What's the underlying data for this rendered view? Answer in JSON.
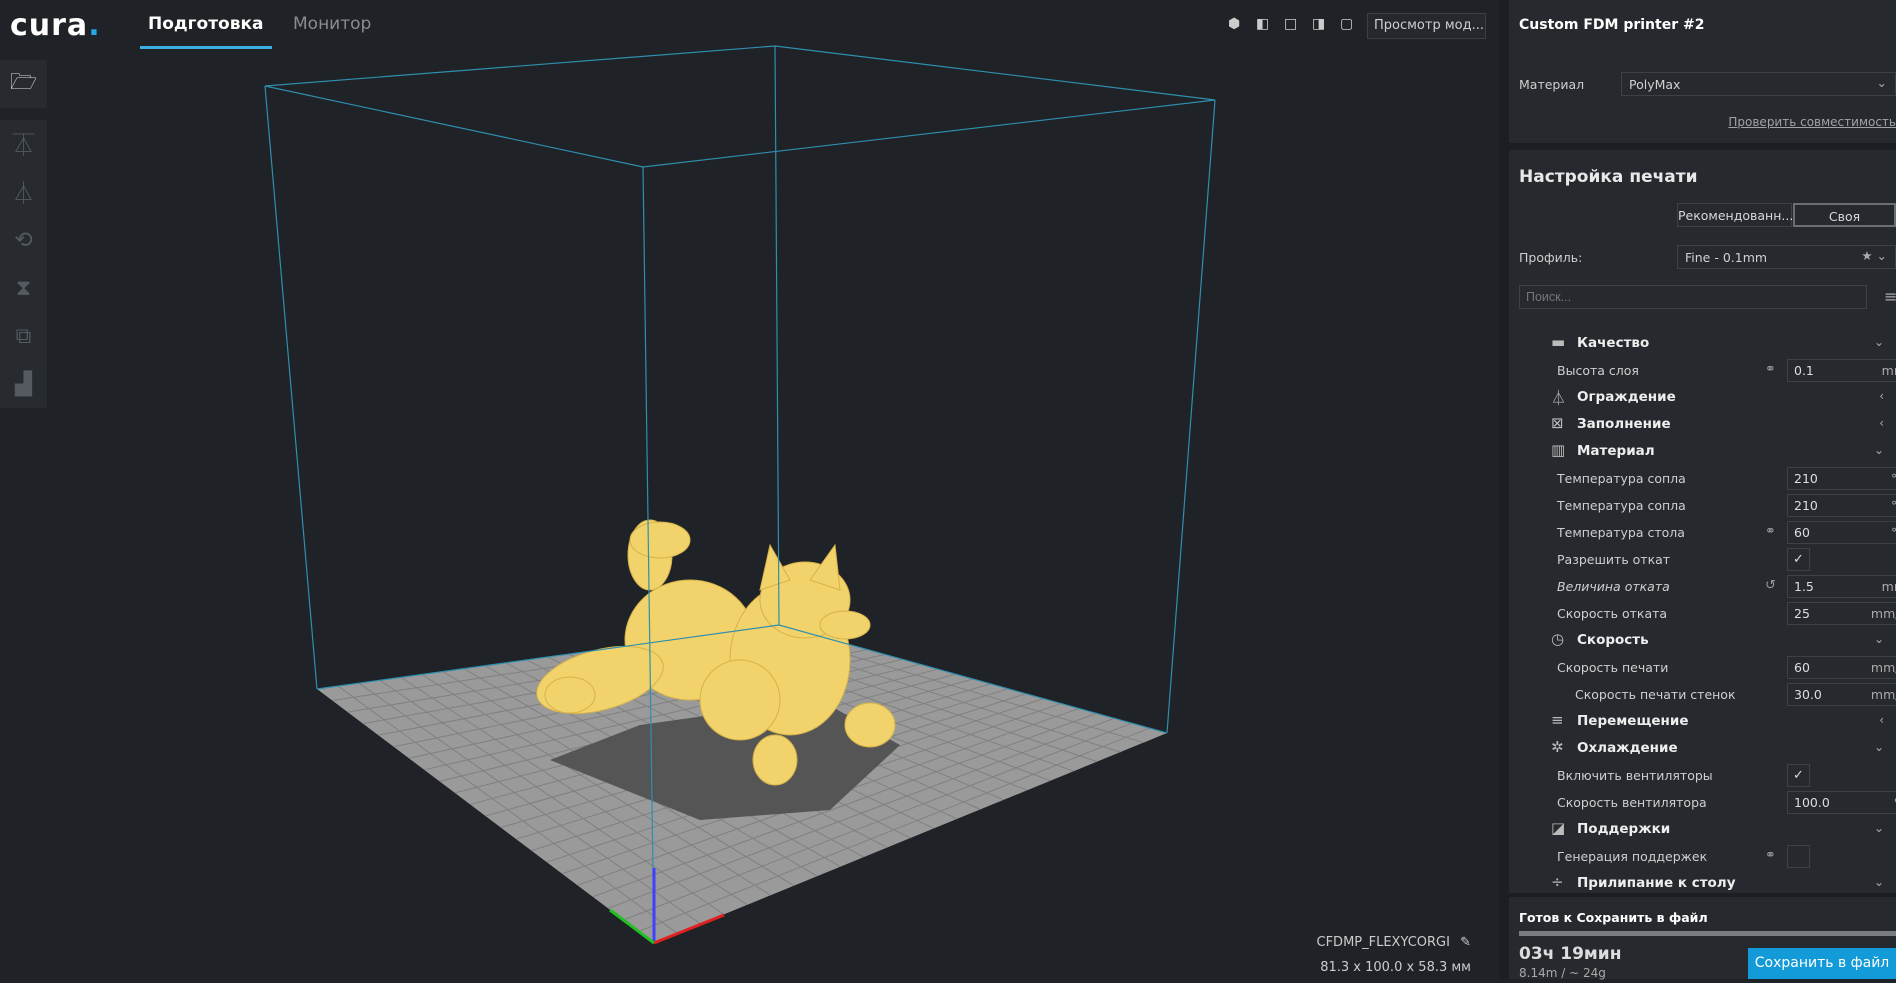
{
  "header": {
    "logo": "cura",
    "tabs": [
      {
        "label": "Подготовка",
        "active": true
      },
      {
        "label": "Монитор",
        "active": false
      }
    ],
    "view_mode": "Просмотр мод...",
    "view_icons": [
      "3d-view-icon",
      "front-view-icon",
      "top-view-icon",
      "left-view-icon",
      "right-view-icon"
    ]
  },
  "toolbar": {
    "open": "folder-open-icon",
    "tools": [
      "move-icon",
      "scale-icon",
      "rotate-icon",
      "mirror-icon",
      "per-model-settings-icon",
      "support-blocker-icon"
    ]
  },
  "model": {
    "name": "CFDMP_FLEXYCORGI",
    "dimensions": "81.3 x 100.0 x 58.3 мм",
    "color": "#f5d76e"
  },
  "printer": {
    "name": "Custom FDM printer #2",
    "material_label": "Материал",
    "material": "PolyMax",
    "check_link": "Проверить совместимость"
  },
  "print_setup": {
    "title": "Настройка печати",
    "mode_recommended": "Рекомендованн...",
    "mode_custom": "Своя",
    "profile_label": "Профиль:",
    "profile": "Fine - 0.1mm",
    "search_placeholder": "Поиск..."
  },
  "settings": [
    {
      "type": "cat",
      "label": "Качество",
      "icon": "▬",
      "expanded": true
    },
    {
      "type": "field",
      "label": "Высота слоя",
      "value": "0.1",
      "unit": "mm",
      "link": true
    },
    {
      "type": "cat",
      "label": "Ограждение",
      "icon": "⏃",
      "expanded": false
    },
    {
      "type": "cat",
      "label": "Заполнение",
      "icon": "⊠",
      "expanded": false
    },
    {
      "type": "cat",
      "label": "Материал",
      "icon": "▥",
      "expanded": true
    },
    {
      "type": "field",
      "label": "Температура сопла",
      "value": "210",
      "unit": "°C"
    },
    {
      "type": "field",
      "label": "Температура сопла",
      "value": "210",
      "unit": "°C"
    },
    {
      "type": "field",
      "label": "Температура стола",
      "value": "60",
      "unit": "°C",
      "link": true
    },
    {
      "type": "check",
      "label": "Разрешить откат",
      "checked": true
    },
    {
      "type": "field",
      "label": "Величина отката",
      "value": "1.5",
      "unit": "mm",
      "reset": true,
      "italic": true
    },
    {
      "type": "field",
      "label": "Скорость отката",
      "value": "25",
      "unit": "mm/s"
    },
    {
      "type": "cat",
      "label": "Скорость",
      "icon": "◷",
      "expanded": true
    },
    {
      "type": "field",
      "label": "Скорость печати",
      "value": "60",
      "unit": "mm/s"
    },
    {
      "type": "field",
      "label": "Скорость печати стенок",
      "value": "30.0",
      "unit": "mm/s",
      "indent": true
    },
    {
      "type": "cat",
      "label": "Перемещение",
      "icon": "≡",
      "expanded": false
    },
    {
      "type": "cat",
      "label": "Охлаждение",
      "icon": "✲",
      "expanded": true
    },
    {
      "type": "check",
      "label": "Включить вентиляторы",
      "checked": true
    },
    {
      "type": "field",
      "label": "Скорость вентилятора",
      "value": "100.0",
      "unit": "%"
    },
    {
      "type": "cat",
      "label": "Поддержки",
      "icon": "◪",
      "expanded": true
    },
    {
      "type": "check",
      "label": "Генерация поддержек",
      "checked": false,
      "link": true
    },
    {
      "type": "cat",
      "label": "Прилипание к столу",
      "icon": "÷",
      "expanded": true
    }
  ],
  "footer": {
    "status": "Готов к Сохранить в файл",
    "progress": 1.0,
    "time": "03ч 19мин",
    "material_usage": "8.14m / ~ 24g",
    "save_button": "Сохранить в файл"
  }
}
